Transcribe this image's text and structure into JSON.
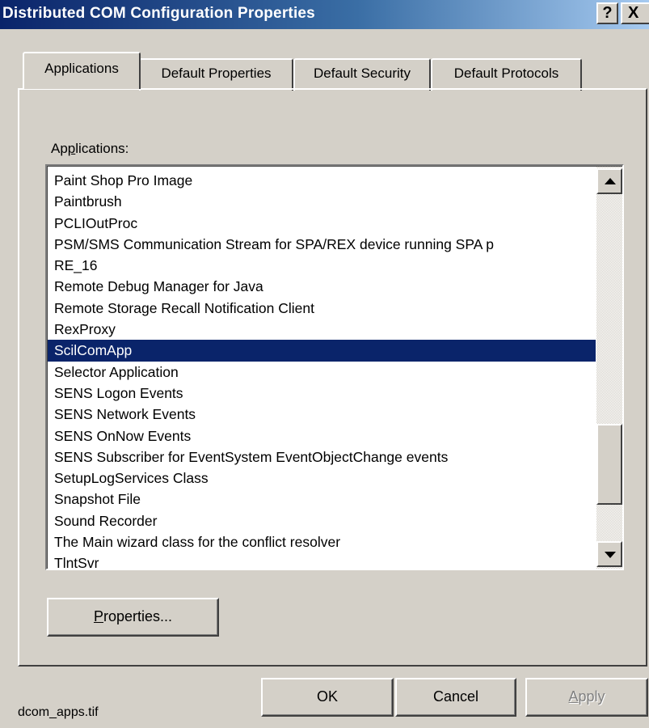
{
  "window": {
    "title": "Distributed COM Configuration Properties",
    "help_glyph": "?",
    "close_glyph": "X"
  },
  "tabs": [
    {
      "label": "Applications",
      "active": true
    },
    {
      "label": "Default Properties"
    },
    {
      "label": "Default Security"
    },
    {
      "label": "Default Protocols"
    }
  ],
  "applications": {
    "label_pre": "Ap",
    "label_key": "p",
    "label_post": "lications:",
    "items": [
      "Paint Shop Pro Image",
      "Paintbrush",
      "PCLIOutProc",
      "PSM/SMS Communication Stream for SPA/REX device running SPA p",
      "RE_16",
      "Remote Debug Manager for Java",
      "Remote Storage Recall Notification Client",
      "RexProxy",
      "ScilComApp",
      "Selector Application",
      "SENS Logon Events",
      "SENS Network Events",
      "SENS OnNow Events",
      "SENS Subscriber for EventSystem EventObjectChange events",
      "SetupLogServices Class",
      "Snapshot File",
      "Sound Recorder",
      "The Main wizard class for the conflict resolver",
      "TlntSvr"
    ],
    "selected_index": 8
  },
  "buttons": {
    "properties_key": "P",
    "properties_rest": "roperties...",
    "ok": "OK",
    "cancel": "Cancel",
    "apply_key": "A",
    "apply_rest": "pply"
  },
  "caption": "dcom_apps.tif",
  "colors": {
    "title_start": "#0a246a",
    "title_end": "#a6caf0",
    "selection": "#0a246a",
    "face": "#d4d0c8"
  }
}
